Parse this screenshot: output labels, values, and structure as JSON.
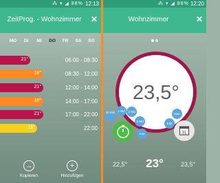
{
  "left": {
    "status": {
      "icons": "⁂ ▾ ◢ 88%",
      "time": "12:13"
    },
    "title": "ZeitProg. - Wohnzimmer",
    "close": "✕",
    "days": [
      "MO",
      "DI",
      "MI",
      "DO",
      "FR",
      "SA",
      "SO"
    ],
    "active_day": "DO",
    "schedule": [
      {
        "temp": "21°",
        "range": "06:00 - 08:30",
        "color": "#b8134a",
        "fill": 0.3
      },
      {
        "temp": "18°",
        "range": "08:30 - 12:00",
        "color": "#ff8a24",
        "fill": 0.43
      },
      {
        "temp": "21°",
        "range": "12:00 - 14:00",
        "color": "#b8134a",
        "fill": 0.43
      },
      {
        "temp": "18°",
        "range": "14:00 - 17:00",
        "color": "#ff8a24",
        "fill": 0.43
      },
      {
        "temp": "21°",
        "range": "17:00 - 22:00",
        "color": "#b8134a",
        "fill": 0.43
      },
      {
        "temp": "15°",
        "range": "22:00",
        "color": "#f4d21a",
        "fill": 0.37
      }
    ],
    "actions": {
      "copy": "Kopieren",
      "add": "Hinzufügen"
    }
  },
  "right": {
    "status": {
      "icons": "⁂ ▾ ◢ 88%",
      "time": "12:20"
    },
    "title": "Wohnzimmer",
    "close": "✕",
    "current_temp": "23,5°",
    "chips": {
      "min30": "30 Min",
      "std1": "1 Std",
      "std2": "2 Std",
      "std3": "3 Std",
      "aus": "Aus",
      "man": "Man",
      "edit": "Edit"
    },
    "calendar_day": "31",
    "temps": {
      "left": "22,5°",
      "target": "23°",
      "right": "23,5°"
    }
  },
  "colors": {
    "appbar": "#40b88f",
    "statusbar": "#2f9c79",
    "ring": "#a0154a",
    "divider": "#ff8a24",
    "chip": "#5aa7dd",
    "timer": "#4dbc45"
  }
}
